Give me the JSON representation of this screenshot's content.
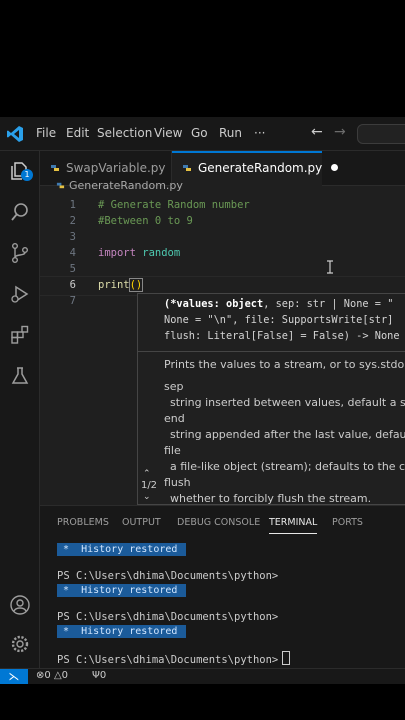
{
  "menubar": {
    "items": [
      "File",
      "Edit",
      "Selection",
      "View",
      "Go",
      "Run",
      "···"
    ]
  },
  "activity": {
    "scm_badge": "1"
  },
  "tabs": [
    {
      "label": "SwapVariable.py"
    },
    {
      "label": "GenerateRandom.py"
    }
  ],
  "breadcrumb": "GenerateRandom.py",
  "editor": {
    "line_numbers": [
      "1",
      "2",
      "3",
      "4",
      "5",
      "6",
      "7"
    ],
    "line1": "# Generate Random number",
    "line2": "#Between 0 to 9",
    "line4_kw": "import",
    "line4_mod": "random",
    "line6_fn": "print",
    "line6_paren": "()"
  },
  "hover": {
    "sig_line1_bold": "(*values: object",
    "sig_line1_rest": ", sep: str | None = \"",
    "sig_line2": "None = \"\\n\", file: SupportsWrite[str]",
    "sig_line3": "flush: Literal[False] = False) -> None",
    "doc": "Prints the values to a stream, or to sys.stdout b",
    "params": [
      {
        "name": "sep",
        "desc": "string inserted between values, default a spac"
      },
      {
        "name": "end",
        "desc": "string appended after the last value, default a"
      },
      {
        "name": "file",
        "desc": "a file-like object (stream); defaults to the curre"
      },
      {
        "name": "flush",
        "desc": "whether to forcibly flush the stream."
      }
    ],
    "pager": "1/2"
  },
  "panel": {
    "tabs": [
      "PROBLEMS",
      "OUTPUT",
      "DEBUG CONSOLE",
      "TERMINAL",
      "PORTS"
    ],
    "history_label": " *  History restored ",
    "prompt": "PS C:\\Users\\dhima\\Documents\\python>"
  },
  "statusbar": {
    "problems": "0",
    "warnings": "0",
    "ports": "0"
  },
  "colors": {
    "accent": "#0078d4",
    "editor_bg": "#1f1f1f",
    "chrome_bg": "#181818"
  }
}
